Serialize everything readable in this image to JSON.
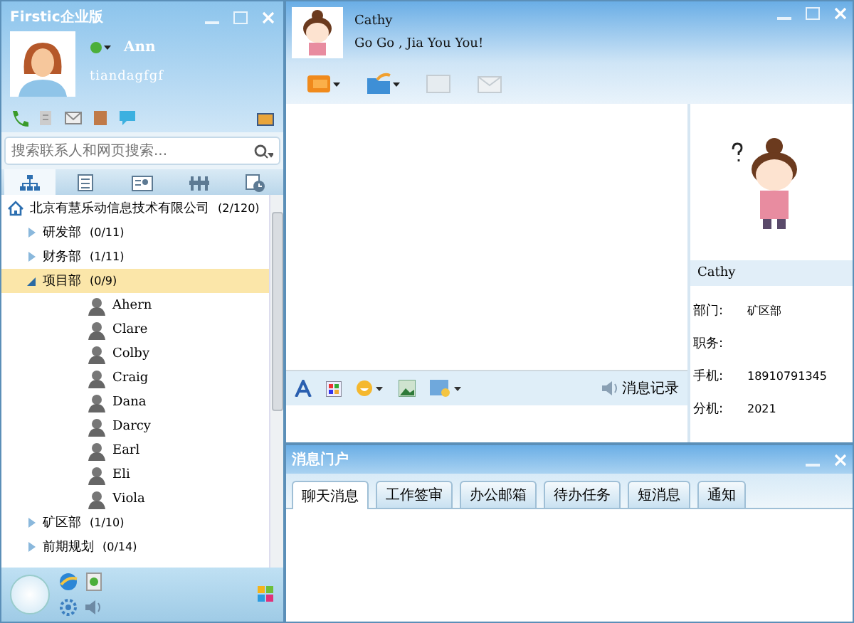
{
  "contacts_window": {
    "title": "Firstic企业版",
    "user": {
      "name": "Ann",
      "signature": "tiandagfgf"
    },
    "search": {
      "placeholder": "搜索联系人和网页搜索..."
    },
    "nav_tabs": [
      {
        "kind": "org",
        "selected": true
      },
      {
        "kind": "list",
        "selected": false
      },
      {
        "kind": "card",
        "selected": false
      },
      {
        "kind": "groups",
        "selected": false
      },
      {
        "kind": "recent",
        "selected": false
      }
    ],
    "tree": [
      {
        "kind": "company",
        "label": "北京有慧乐动信息技术有限公司",
        "count": "(2/120)",
        "selected": false,
        "children": [
          {
            "kind": "department",
            "label": "研发部",
            "count": "(0/11)",
            "expanded": false,
            "selected": false
          },
          {
            "kind": "department",
            "label": "财务部",
            "count": "(1/11)",
            "expanded": false,
            "selected": false
          },
          {
            "kind": "department",
            "label": "项目部",
            "count": "(0/9)",
            "expanded": true,
            "selected": true,
            "children": [
              {
                "kind": "person",
                "label": "Ahern",
                "selected": false
              },
              {
                "kind": "person",
                "label": "Clare",
                "selected": false
              },
              {
                "kind": "person",
                "label": "Colby",
                "selected": false
              },
              {
                "kind": "person",
                "label": "Craig",
                "selected": false
              },
              {
                "kind": "person",
                "label": "Dana",
                "selected": false
              },
              {
                "kind": "person",
                "label": "Darcy",
                "selected": false
              },
              {
                "kind": "person",
                "label": "Earl",
                "selected": false
              },
              {
                "kind": "person",
                "label": "Eli",
                "selected": false
              },
              {
                "kind": "person",
                "label": "Viola",
                "selected": false
              }
            ]
          },
          {
            "kind": "department",
            "label": "矿区部",
            "count": "(1/10)",
            "expanded": false,
            "selected": false
          },
          {
            "kind": "department",
            "label": "前期规划",
            "count": "(0/14)",
            "expanded": false,
            "selected": false
          }
        ]
      }
    ]
  },
  "chat_window": {
    "contact": {
      "name": "Cathy",
      "signature": "Go Go , Jia You You!"
    },
    "history_button": "消息记录",
    "profile": {
      "name": "Cathy",
      "fields": [
        {
          "label": "部门:",
          "value": "矿区部"
        },
        {
          "label": "职务:"
        },
        {
          "label": "手机:",
          "value": "18910791345"
        },
        {
          "label": "分机:",
          "value": "2021"
        }
      ]
    }
  },
  "portal_window": {
    "title": "消息门户",
    "tabs": [
      {
        "label": "聊天消息",
        "selected": true
      },
      {
        "label": "工作签审",
        "selected": false
      },
      {
        "label": "办公邮箱",
        "selected": false
      },
      {
        "label": "待办任务",
        "selected": false
      },
      {
        "label": "短消息",
        "selected": false
      },
      {
        "label": "通知",
        "selected": false
      }
    ]
  }
}
